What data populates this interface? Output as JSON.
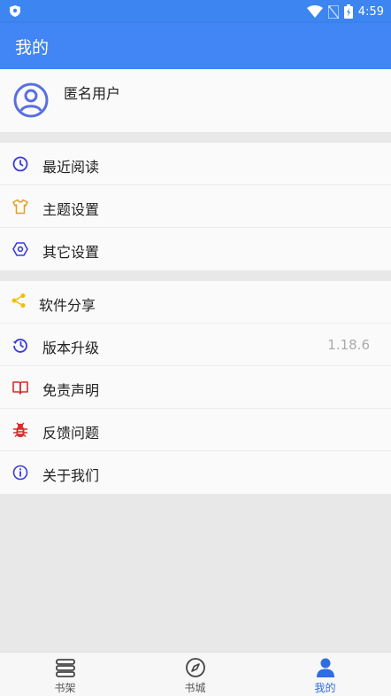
{
  "status_bar": {
    "time": "4:59"
  },
  "app_bar": {
    "title": "我的"
  },
  "user": {
    "name": "匿名用户"
  },
  "group1": [
    {
      "label": "最近阅读",
      "icon": "clock-icon",
      "color": "#3a3adf"
    },
    {
      "label": "主题设置",
      "icon": "tshirt-icon",
      "color": "#e0a020"
    },
    {
      "label": "其它设置",
      "icon": "settings-hexagon-icon",
      "color": "#3a3adf"
    }
  ],
  "group2": [
    {
      "label": "软件分享",
      "icon": "share-icon",
      "color": "#f0c000"
    },
    {
      "label": "版本升级",
      "icon": "history-icon",
      "color": "#3a3adf",
      "value": "1.18.6"
    },
    {
      "label": "免责声明",
      "icon": "book-icon",
      "color": "#d62c2c"
    },
    {
      "label": "反馈问题",
      "icon": "bug-icon",
      "color": "#d62c2c"
    },
    {
      "label": "关于我们",
      "icon": "info-icon",
      "color": "#3a3adf"
    }
  ],
  "bottom_nav": [
    {
      "label": "书架",
      "icon": "bookshelf-icon"
    },
    {
      "label": "书城",
      "icon": "compass-icon"
    },
    {
      "label": "我的",
      "icon": "person-icon",
      "active": true
    }
  ],
  "colors": {
    "primary": "#4285f4",
    "active_tab": "#2f6de0"
  }
}
